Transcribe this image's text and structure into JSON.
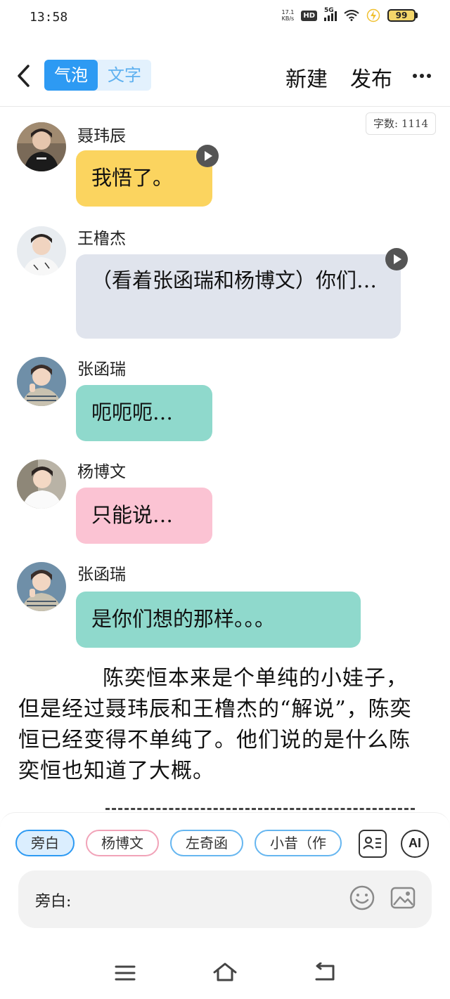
{
  "status_bar": {
    "time": "13:58",
    "net_speed_value": "17.1",
    "net_speed_unit": "KB/s",
    "hd": "HD",
    "network": "5G",
    "battery": "99"
  },
  "header": {
    "tab_bubble": "气泡",
    "tab_text": "文字",
    "new_label": "新建",
    "publish_label": "发布",
    "more_label": "···"
  },
  "word_count": "字数: 1114",
  "messages": [
    {
      "speaker": "聂玮辰",
      "text": "我悟了。",
      "color": "#fbd45f",
      "has_audio": true
    },
    {
      "speaker": "王橹杰",
      "text": "（看着张函瑞和杨博文）你们…",
      "color": "#e0e4ed",
      "has_audio": true
    },
    {
      "speaker": "张函瑞",
      "text": "呃呃呃…",
      "color": "#8fd9cc",
      "has_audio": false
    },
    {
      "speaker": "杨博文",
      "text": "只能说…",
      "color": "#fbc3d3",
      "has_audio": false
    },
    {
      "speaker": "张函瑞",
      "text": "是你们想的那样。。。",
      "color": "#8fd9cc",
      "has_audio": false
    }
  ],
  "narration": "陈奕恒本来是个单纯的小娃子，但是经过聂玮辰和王橹杰的“解说”，陈奕恒已经变得不单纯了。他们说的是什么陈奕恒也知道了大概。",
  "role_chips": [
    "旁白",
    "杨博文",
    "左奇函",
    "小昔（作"
  ],
  "ai_label": "AI",
  "input": {
    "label": "旁白:",
    "value": "",
    "placeholder": ""
  },
  "icons": [
    "back-icon",
    "play-icon",
    "list-icon",
    "emoji-icon",
    "image-icon",
    "menu-icon",
    "home-icon",
    "return-icon"
  ]
}
